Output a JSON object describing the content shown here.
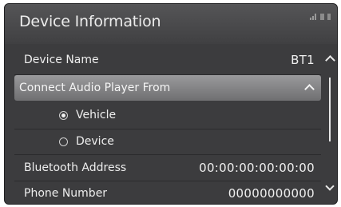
{
  "screen": {
    "title": "Device Information",
    "status_icons": [
      "signal-icon",
      "bluetooth-icon",
      "battery-icon"
    ]
  },
  "items": {
    "device_name": {
      "label": "Device Name",
      "value": "BT1"
    },
    "connect_audio": {
      "label": "Connect Audio Player From",
      "expanded": true
    },
    "options": [
      {
        "label": "Vehicle",
        "selected": true
      },
      {
        "label": "Device",
        "selected": false
      }
    ],
    "bluetooth_address": {
      "label": "Bluetooth Address",
      "value": "00:00:00:00:00:00"
    },
    "phone_number": {
      "label": "Phone Number",
      "value": "00000000000"
    }
  },
  "scroll": {
    "position": 0.2
  }
}
